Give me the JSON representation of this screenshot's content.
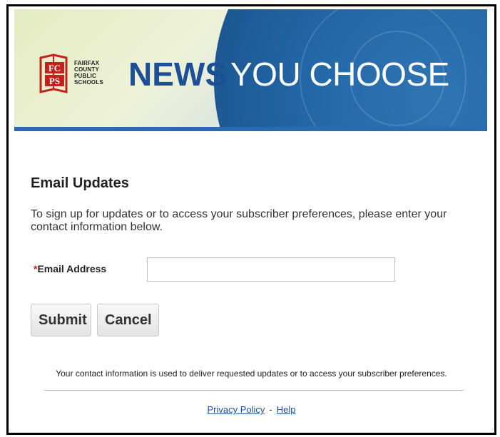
{
  "banner": {
    "logo_lines": [
      "FAIRFAX",
      "COUNTY",
      "PUBLIC",
      "SCHOOLS"
    ],
    "logo_mark_top": "FC",
    "logo_mark_bottom": "PS",
    "title_bold": "NEWS",
    "title_light": "YOU CHOOSE"
  },
  "form": {
    "heading": "Email Updates",
    "intro": "To sign up for updates or to access your subscriber preferences, please enter your contact information below.",
    "email_required_marker": "*",
    "email_label": "Email Address",
    "email_value": "",
    "submit_label": "Submit",
    "cancel_label": "Cancel"
  },
  "footer": {
    "note": "Your contact information is used to deliver requested updates or to access your subscriber preferences.",
    "privacy_label": "Privacy Policy",
    "separator": "-",
    "help_label": "Help"
  },
  "colors": {
    "brand_blue": "#1d4f96",
    "required_red": "#c0231c",
    "logo_red": "#c0231c"
  }
}
